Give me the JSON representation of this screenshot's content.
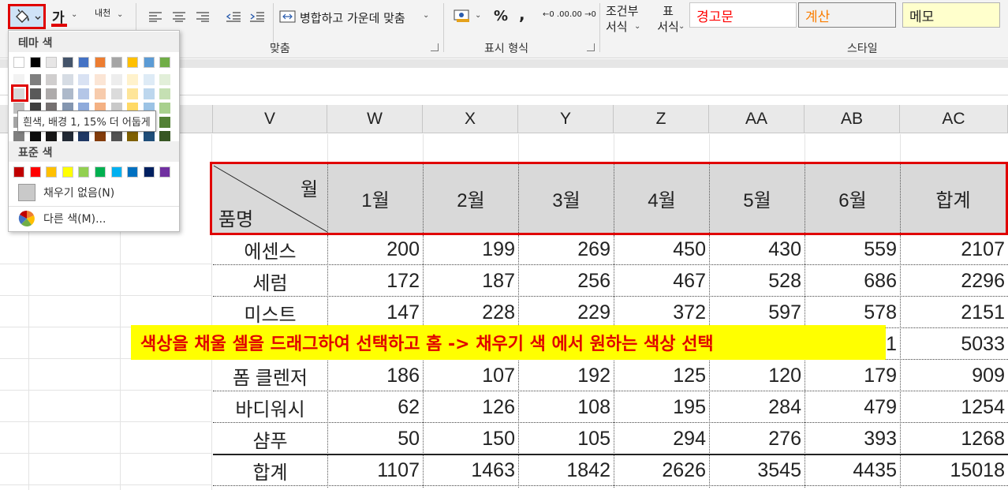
{
  "ribbon": {
    "fill_button_label": "채우기 색",
    "font_color_label": "가",
    "phonetic_label": "내천",
    "merge_label": "병합하고 가운데 맞춤",
    "alignment_group": "맞춤",
    "percent": "%",
    "comma": ",",
    "inc_decimal": "←0 .00",
    "dec_decimal": ".00 →0",
    "number_group": "표시 형식",
    "conditional_format": [
      "조건부",
      "서식"
    ],
    "table_format": [
      "표",
      "서식"
    ],
    "styles_group": "스타일",
    "styles": [
      {
        "label": "경고문",
        "color": "#ff0000",
        "bg": "#ffffff"
      },
      {
        "label": "계산",
        "color": "#fa7d00",
        "bg": "#f2f2f2"
      },
      {
        "label": "메모",
        "color": "#222222",
        "bg": "#ffffcc"
      }
    ]
  },
  "columns": [
    "V",
    "W",
    "X",
    "Y",
    "Z",
    "AA",
    "AB",
    "AC"
  ],
  "table": {
    "corner_top": "월",
    "corner_bottom": "품명",
    "headers": [
      "1월",
      "2월",
      "3월",
      "4월",
      "5월",
      "6월",
      "합계"
    ],
    "rows": [
      {
        "name": "에센스",
        "values": [
          "200",
          "199",
          "269",
          "450",
          "430",
          "559",
          "2107"
        ]
      },
      {
        "name": "세럼",
        "values": [
          "172",
          "187",
          "256",
          "467",
          "528",
          "686",
          "2296"
        ]
      },
      {
        "name": "미스트",
        "values": [
          "147",
          "228",
          "229",
          "372",
          "597",
          "578",
          "2151"
        ]
      },
      {
        "name": "",
        "values": [
          "",
          "",
          "",
          "",
          "",
          "1",
          "5033"
        ]
      },
      {
        "name": "폼 클렌저",
        "values": [
          "186",
          "107",
          "192",
          "125",
          "120",
          "179",
          "909"
        ]
      },
      {
        "name": "바디워시",
        "values": [
          "62",
          "126",
          "108",
          "195",
          "284",
          "479",
          "1254"
        ]
      },
      {
        "name": "샴푸",
        "values": [
          "50",
          "150",
          "105",
          "294",
          "276",
          "393",
          "1268"
        ]
      },
      {
        "name": "합계",
        "values": [
          "1107",
          "1463",
          "1842",
          "2626",
          "3545",
          "4435",
          "15018"
        ]
      }
    ]
  },
  "fill_menu": {
    "theme_title": "테마 색",
    "theme_top": [
      "#ffffff",
      "#000000",
      "#e7e6e6",
      "#44546a",
      "#4472c4",
      "#ed7d31",
      "#a5a5a5",
      "#ffc000",
      "#5b9bd5",
      "#70ad47"
    ],
    "theme_shades": [
      [
        "#f2f2f2",
        "#7f7f7f",
        "#d0cece",
        "#d6dce4",
        "#d9e2f3",
        "#fbe5d5",
        "#ededed",
        "#fff2cc",
        "#deebf6",
        "#e2efd9"
      ],
      [
        "#d8d8d8",
        "#595959",
        "#aeabab",
        "#adb9ca",
        "#b4c6e7",
        "#f7cbac",
        "#dbdbdb",
        "#fee599",
        "#bdd7ee",
        "#c5e0b3"
      ],
      [
        "#bfbfbf",
        "#3f3f3f",
        "#757070",
        "#8496b0",
        "#8eaadb",
        "#f4b183",
        "#c9c9c9",
        "#ffd965",
        "#9cc3e5",
        "#a8d08d"
      ],
      [
        "#a5a5a5",
        "#262626",
        "#3a3838",
        "#323f4f",
        "#2f5496",
        "#c55a11",
        "#7b7b7b",
        "#bf9000",
        "#2e75b5",
        "#538135"
      ],
      [
        "#7f7f7f",
        "#0c0c0c",
        "#171616",
        "#222a35",
        "#1f3864",
        "#833c0b",
        "#525252",
        "#7f6000",
        "#1f4e79",
        "#375623"
      ]
    ],
    "tooltip": "흰색, 배경 1, 15% 더 어둡게",
    "standard_title": "표준 색",
    "standard": [
      "#c00000",
      "#ff0000",
      "#ffc000",
      "#ffff00",
      "#92d050",
      "#00b050",
      "#00b0f0",
      "#0070c0",
      "#002060",
      "#7030a0"
    ],
    "no_fill": "채우기 없음(N)",
    "more_colors": "다른 색(M)..."
  },
  "annotation": "색상을 채울 셀을 드래그하여 선택하고 홈 -> 채우기 색 에서 원하는 색상 선택"
}
